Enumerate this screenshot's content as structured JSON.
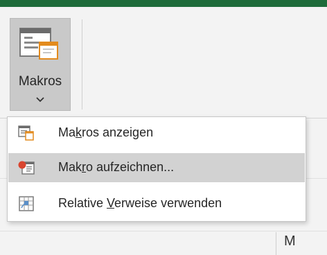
{
  "ribbon": {
    "macros_button": {
      "label": "Makros",
      "icon": "macros-icon",
      "dropdown_icon": "chevron-down-icon"
    }
  },
  "menu": {
    "items": [
      {
        "pre": "Ma",
        "key": "k",
        "post": "ros anzeigen",
        "icon": "view-macros-icon"
      },
      {
        "pre": "Mak",
        "key": "r",
        "post": "o aufzeichnen...",
        "icon": "record-macro-icon",
        "highlighted": true
      },
      {
        "pre": "Relative ",
        "key": "V",
        "post": "erweise verwenden",
        "icon": "relative-references-icon"
      }
    ]
  },
  "sheet": {
    "column_header": "M"
  },
  "colors": {
    "title_bar": "#1e6b3a",
    "menu_highlight": "#d2d2d2",
    "button_pressed": "#c9c9c9",
    "record_dot": "#d9452f"
  }
}
